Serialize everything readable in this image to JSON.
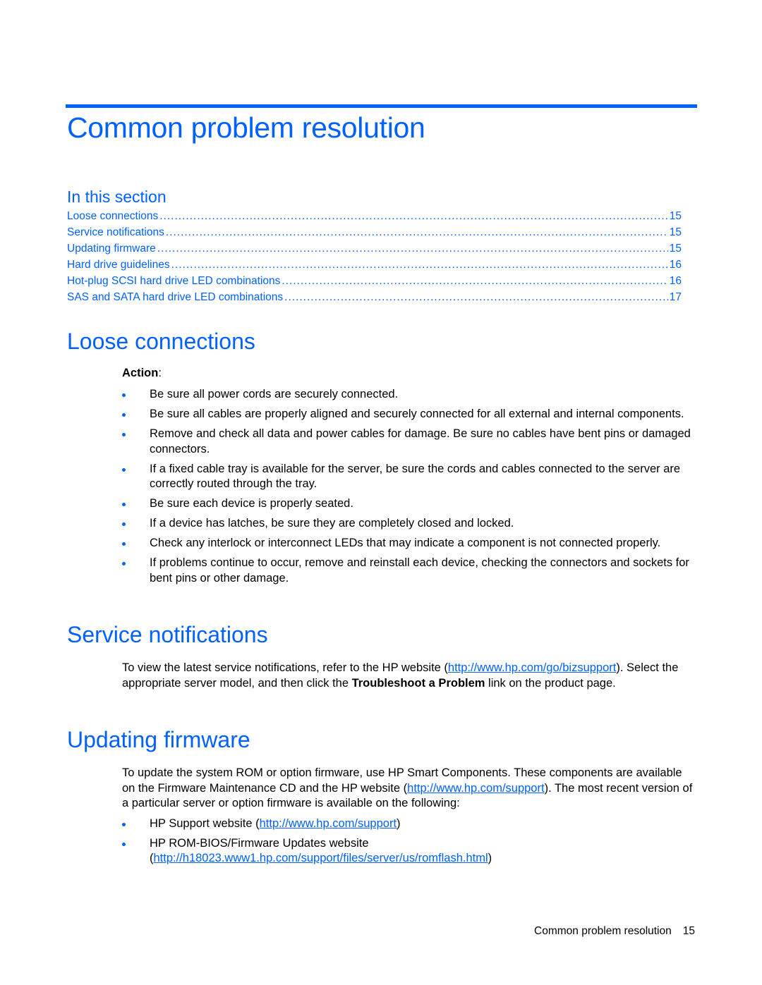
{
  "chapter_title": "Common problem resolution",
  "in_this_section": {
    "heading": "In this section",
    "entries": [
      {
        "label": "Loose connections",
        "page": "15"
      },
      {
        "label": "Service notifications",
        "page": "15"
      },
      {
        "label": "Updating firmware",
        "page": "15"
      },
      {
        "label": "Hard drive guidelines",
        "page": "16"
      },
      {
        "label": "Hot-plug SCSI hard drive LED combinations",
        "page": "16"
      },
      {
        "label": "SAS and SATA hard drive LED combinations",
        "page": "17"
      }
    ]
  },
  "loose_connections": {
    "heading": "Loose connections",
    "action_label": "Action",
    "action_colon": ":",
    "bullets": [
      "Be sure all power cords are securely connected.",
      "Be sure all cables are properly aligned and securely connected for all external and internal components.",
      "Remove and check all data and power cables for damage. Be sure no cables have bent pins or damaged connectors.",
      "If a fixed cable tray is available for the server, be sure the cords and cables connected to the server are correctly routed through the tray.",
      "Be sure each device is properly seated.",
      "If a device has latches, be sure they are completely closed and locked.",
      "Check any interlock or interconnect LEDs that may indicate a component is not connected properly.",
      "If problems continue to occur, remove and reinstall each device, checking the connectors and sockets for bent pins or other damage."
    ]
  },
  "service_notifications": {
    "heading": "Service notifications",
    "text_1": "To view the latest service notifications, refer to the HP website (",
    "link": "http://www.hp.com/go/bizsupport",
    "text_2": "). Select the appropriate server model, and then click the ",
    "bold": "Troubleshoot a Problem",
    "text_3": " link on the product page."
  },
  "updating_firmware": {
    "heading": "Updating firmware",
    "text_1": "To update the system ROM or option firmware, use HP Smart Components. These components are available on the Firmware Maintenance CD and the HP website (",
    "link": "http://www.hp.com/support",
    "text_2": "). The most recent version of a particular server or option firmware is available on the following:",
    "bullets": [
      {
        "text": "HP Support website (",
        "link": "http://www.hp.com/support",
        "after": ")"
      },
      {
        "text": "HP ROM-BIOS/Firmware Updates website (",
        "link": "http://h18023.www1.hp.com/support/files/server/us/romflash.html",
        "after": ")"
      }
    ]
  },
  "footer": {
    "title": "Common problem resolution",
    "page": "15"
  }
}
